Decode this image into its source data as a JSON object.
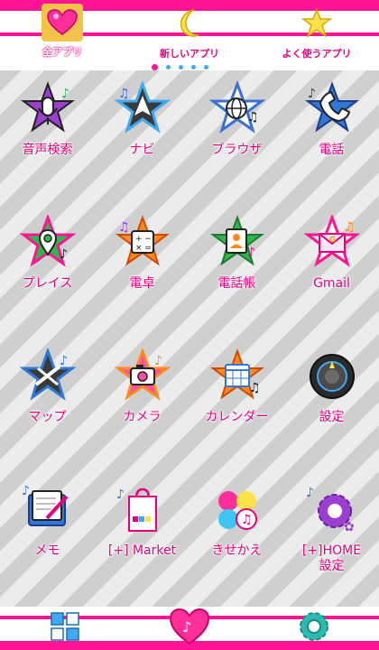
{
  "tabs": [
    {
      "label": "全アプリ",
      "icon": "heart-icon",
      "active": true
    },
    {
      "label": "新しいアプリ",
      "icon": "moon-icon",
      "active": false
    },
    {
      "label": "よく使うアプリ",
      "icon": "star-icon",
      "active": false
    }
  ],
  "apps": [
    {
      "label": "音声検索",
      "icon": "microphone-icon"
    },
    {
      "label": "ナビ",
      "icon": "navigation-icon"
    },
    {
      "label": "ブラウザ",
      "icon": "globe-icon"
    },
    {
      "label": "電話",
      "icon": "phone-icon"
    },
    {
      "label": "プレイス",
      "icon": "map-pin-icon"
    },
    {
      "label": "電卓",
      "icon": "calculator-icon"
    },
    {
      "label": "電話帳",
      "icon": "contacts-icon"
    },
    {
      "label": "Gmail",
      "icon": "mail-icon"
    },
    {
      "label": "マップ",
      "icon": "map-icon"
    },
    {
      "label": "カメラ",
      "icon": "camera-icon"
    },
    {
      "label": "カレンダー",
      "icon": "calendar-icon"
    },
    {
      "label": "設定",
      "icon": "settings-knob-icon"
    },
    {
      "label": "メモ",
      "icon": "memo-icon"
    },
    {
      "label": "[+] Market",
      "icon": "shopping-bag-icon"
    },
    {
      "label": "きせかえ",
      "icon": "theme-icon"
    },
    {
      "label": "[+]HOME\n設定",
      "icon": "gear-icon"
    }
  ],
  "dock": [
    {
      "icon": "grid-icon"
    },
    {
      "icon": "heart-music-icon"
    },
    {
      "icon": "cog-icon"
    }
  ],
  "colors": {
    "accent": "#ff1493",
    "label": "#e6007e",
    "dot": "#3fa9f5"
  }
}
